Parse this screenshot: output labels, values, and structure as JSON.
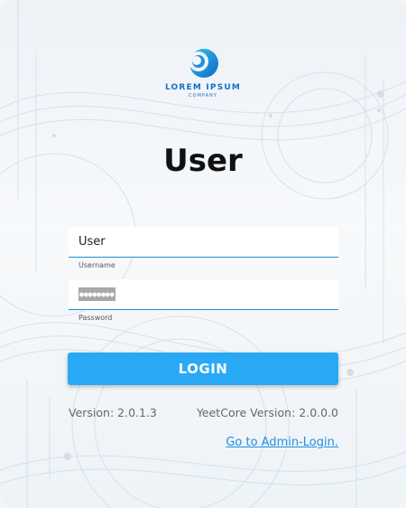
{
  "logo": {
    "name": "LOREM IPSUM",
    "subtitle": "COMPANY",
    "icon": "crescent-sphere-icon"
  },
  "title": "User",
  "form": {
    "username": {
      "value": "User",
      "label": "Username"
    },
    "password": {
      "masked_value": "●●●●●●●●",
      "label": "Password"
    }
  },
  "login_button": "LOGIN",
  "versions": {
    "app": "Version: 2.0.1.3",
    "core": "YeetCore Version: 2.0.0.0"
  },
  "admin_link": "Go to Admin-Login.",
  "colors": {
    "accent": "#29a9f5",
    "link": "#1e90e0",
    "logo": "#1670c8",
    "background": "#edf2f7"
  }
}
